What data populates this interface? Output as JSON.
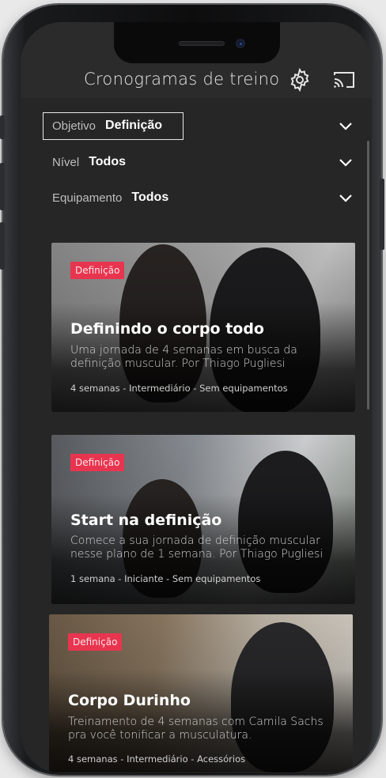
{
  "header": {
    "title": "Cronogramas de treino",
    "settings_icon": "gear-icon",
    "cast_icon": "cast-icon"
  },
  "filters": [
    {
      "label": "Objetivo",
      "value": "Definição",
      "icon": "chevron-down-icon"
    },
    {
      "label": "Nível",
      "value": "Todos",
      "icon": "chevron-down-icon"
    },
    {
      "label": "Equipamento",
      "value": "Todos",
      "icon": "chevron-down-icon"
    }
  ],
  "cards": [
    {
      "badge": "Definição",
      "title": "Definindo o corpo todo",
      "description": "Uma jornada de 4 semanas em busca da definição muscular. Por Thiago Pugliesi",
      "meta": "4 semanas - Intermediário - Sem equipamentos"
    },
    {
      "badge": "Definição",
      "title": "Start na definição",
      "description": "Comece a sua jornada de definição muscular nesse plano de 1 semana. Por Thiago Pugliesi",
      "meta": "1 semana - Iniciante - Sem equipamentos"
    },
    {
      "badge": "Definição",
      "title": "Corpo Durinho",
      "description": "Treinamento de 4 semanas com Camila Sachs pra você tonificar a musculatura.",
      "meta": "4 semanas - Intermediário - Acessórios"
    }
  ],
  "colors": {
    "badge": "#e8354f",
    "background": "#262626",
    "header": "#2b2b2b"
  }
}
